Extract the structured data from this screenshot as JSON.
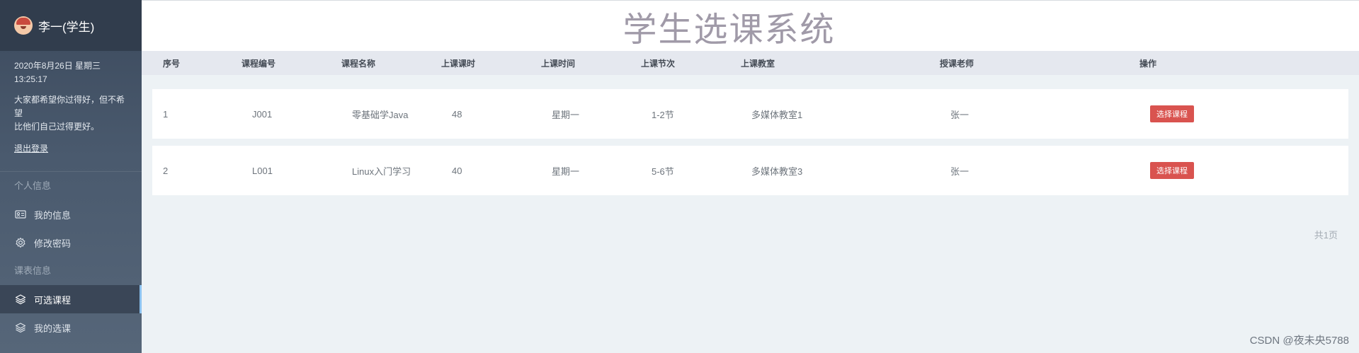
{
  "sidebar": {
    "user_name": "李一(学生)",
    "datetime_line1": "2020年8月26日 星期三",
    "datetime_line2": "13:25:17",
    "motto_line1": "大家都希望你过得好，但不希望",
    "motto_line2": "比他们自己过得更好。",
    "logout_label": "退出登录",
    "section_personal": "个人信息",
    "item_my_info": "我的信息",
    "item_change_password": "修改密码",
    "section_schedule": "课表信息",
    "item_available_courses": "可选课程",
    "item_my_courses": "我的选课"
  },
  "header": {
    "title": "学生选课系统"
  },
  "table": {
    "columns": [
      "序号",
      "课程编号",
      "课程名称",
      "上课课时",
      "上课时间",
      "上课节次",
      "上课教室",
      "授课老师",
      "操作"
    ],
    "rows": [
      {
        "no": "1",
        "code": "J001",
        "name": "零基础学Java",
        "hours": "48",
        "day": "星期一",
        "period": "1-2节",
        "room": "多媒体教室1",
        "teacher": "张一",
        "action": "选择课程"
      },
      {
        "no": "2",
        "code": "L001",
        "name": "Linux入门学习",
        "hours": "40",
        "day": "星期一",
        "period": "5-6节",
        "room": "多媒体教室3",
        "teacher": "张一",
        "action": "选择课程"
      }
    ]
  },
  "pager": {
    "total_pages": "共1页"
  },
  "watermark": "CSDN @夜未央5788",
  "icons": {
    "my_info": "id-card-icon",
    "change_password": "gear-icon",
    "available_courses": "layers-icon",
    "my_courses": "layers-icon"
  },
  "colors": {
    "sidebar_bg": "#3c4a5d",
    "accent_button": "#d9534f",
    "table_header_bg": "#e5e8ef",
    "title_color": "#a09aa8"
  }
}
